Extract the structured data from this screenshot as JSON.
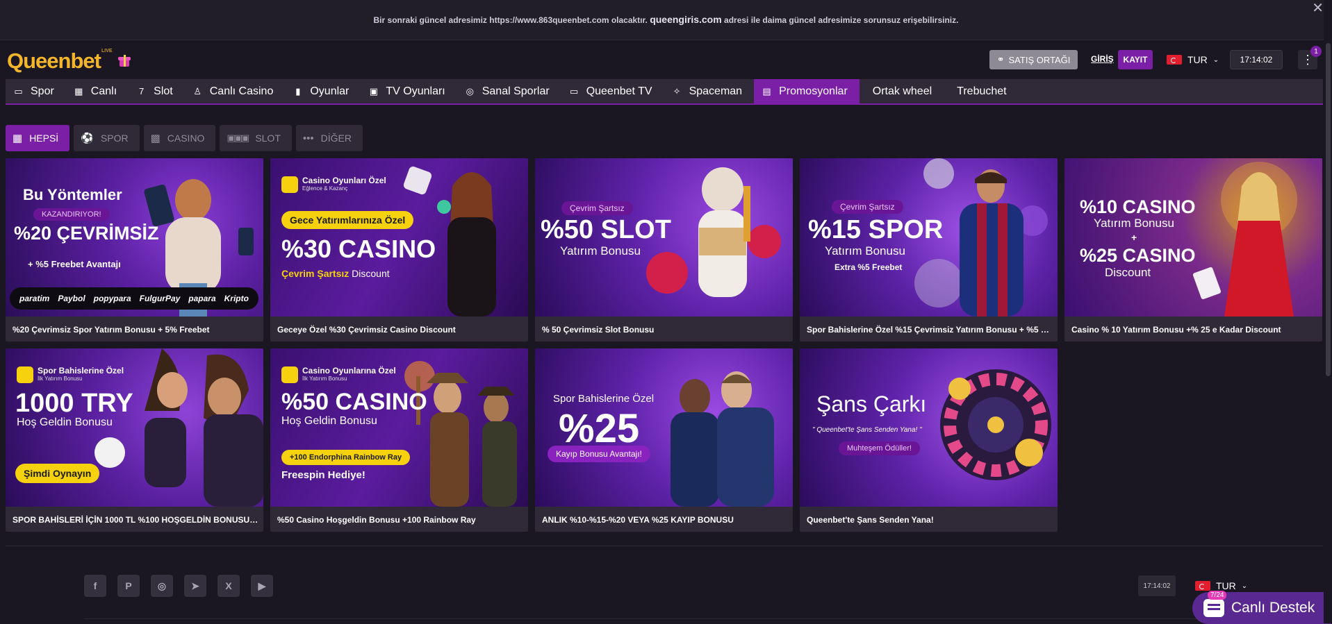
{
  "notice": {
    "text_before": "Bir sonraki güncel adresimiz https://www.863queenbet.com olacaktır.",
    "highlight": "queengiris.com",
    "text_after": "adresi ile daima güncel adresimize sorunsuz erişebilirsiniz.",
    "close": "✕"
  },
  "header": {
    "logo": "Queenbet",
    "logo_suffix": "LIVE",
    "affiliate_label": "SATIŞ ORTAĞI",
    "login_label": "GİRİŞ",
    "register_label": "KAYIT",
    "lang_label": "TUR",
    "time": "17:14:02",
    "menu_badge": "1"
  },
  "nav": [
    {
      "label": "Spor",
      "icon": "▭"
    },
    {
      "label": "Canlı",
      "icon": "▦"
    },
    {
      "label": "Slot",
      "icon": "7"
    },
    {
      "label": "Canlı Casino",
      "icon": "♙"
    },
    {
      "label": "Oyunlar",
      "icon": "▮"
    },
    {
      "label": "TV Oyunları",
      "icon": "▣"
    },
    {
      "label": "Sanal Sporlar",
      "icon": "◎"
    },
    {
      "label": "Queenbet TV",
      "icon": "▭"
    },
    {
      "label": "Spaceman",
      "icon": "✧"
    },
    {
      "label": "Promosyonlar",
      "icon": "▤"
    },
    {
      "label": "Ortak wheel",
      "icon": ""
    },
    {
      "label": "Trebuchet",
      "icon": ""
    }
  ],
  "filters": [
    {
      "label": "HEPSİ"
    },
    {
      "label": "SPOR"
    },
    {
      "label": "CASINO"
    },
    {
      "label": "SLOT"
    },
    {
      "label": "DİĞER"
    }
  ],
  "cards": [
    {
      "caption": "%20 Çevrimsiz Spor Yatırım Bonusu + 5% Freebet",
      "t1": "Bu Yöntemler",
      "pill": "KAZANDIRIYOR!",
      "t2": "%20 ÇEVRİMSİZ",
      "t3": "+ %5 Freebet Avantajı",
      "payments": [
        "paratim",
        "Paybol",
        "popypara",
        "FulgurPay",
        "papara",
        "Kripto"
      ]
    },
    {
      "caption": "Geceye Özel %30 Çevrimsiz Casino Discount",
      "tag": "Casino Oyunları Özel",
      "tag_sub": "Eğlence & Kazanç",
      "pill": "Gece Yatırımlarınıza Özel",
      "t1": "%30 CASINO",
      "t2a": "Çevrim Şartsız",
      "t2b": "Discount"
    },
    {
      "caption": "% 50 Çevrimsiz Slot Bonusu",
      "pill": "Çevrim Şartsız",
      "t1": "%50 SLOT",
      "t2": "Yatırım Bonusu"
    },
    {
      "caption": "Spor Bahislerine Özel %15 Çevrimsiz Yatırım Bonusu + %5 Freebet",
      "pill": "Çevrim Şartsız",
      "t1": "%15 SPOR",
      "t2": "Yatırım Bonusu",
      "t3": "Extra %5 Freebet"
    },
    {
      "caption": "Casino % 10 Yatırım Bonusu +% 25 e Kadar Discount",
      "t1": "%10 CASINO",
      "t2": "Yatırım Bonusu",
      "plus": "+",
      "t3": "%25 CASINO",
      "t4": "Discount"
    },
    {
      "caption": "SPOR BAHİSLERİ İÇİN 1000 TL %100 HOŞGELDİN BONUSU + %5 Freebet",
      "tag": "Spor Bahislerine Özel",
      "tag_sub": "İlk Yatırım Bonusu",
      "t1": "1000 TRY",
      "t2": "Hoş Geldin Bonusu",
      "pill": "Şimdi Oynayın"
    },
    {
      "caption": "%50 Casino Hoşgeldin Bonusu +100 Rainbow Ray",
      "tag": "Casino Oyunlarına Özel",
      "tag_sub": "İlk Yatırım Bonusu",
      "t1": "%50 CASINO",
      "t2": "Hoş Geldin Bonusu",
      "pill": "+100 Endorphina Rainbow Ray",
      "t3": "Freespin Hediye!"
    },
    {
      "caption": "ANLIK %10-%15-%20 VEYA %25 KAYIP BONUSU",
      "t1": "Spor Bahislerine Özel",
      "t2": "%25",
      "pill": "Kayıp Bonusu Avantajı!"
    },
    {
      "caption": "Queenbet'te Şans Senden Yana!",
      "t1": "Şans Çarkı",
      "t2": "\" Queenbet'te Şans Senden Yana! \"",
      "pill": "Muhteşem Ödüller!"
    }
  ],
  "footer": {
    "social": [
      "f",
      "P",
      "◎",
      "➤",
      "X",
      "▶"
    ],
    "time": "17:14:02",
    "lang_label": "TUR",
    "support_label": "Canlı Destek",
    "support_badge": "7/24"
  }
}
